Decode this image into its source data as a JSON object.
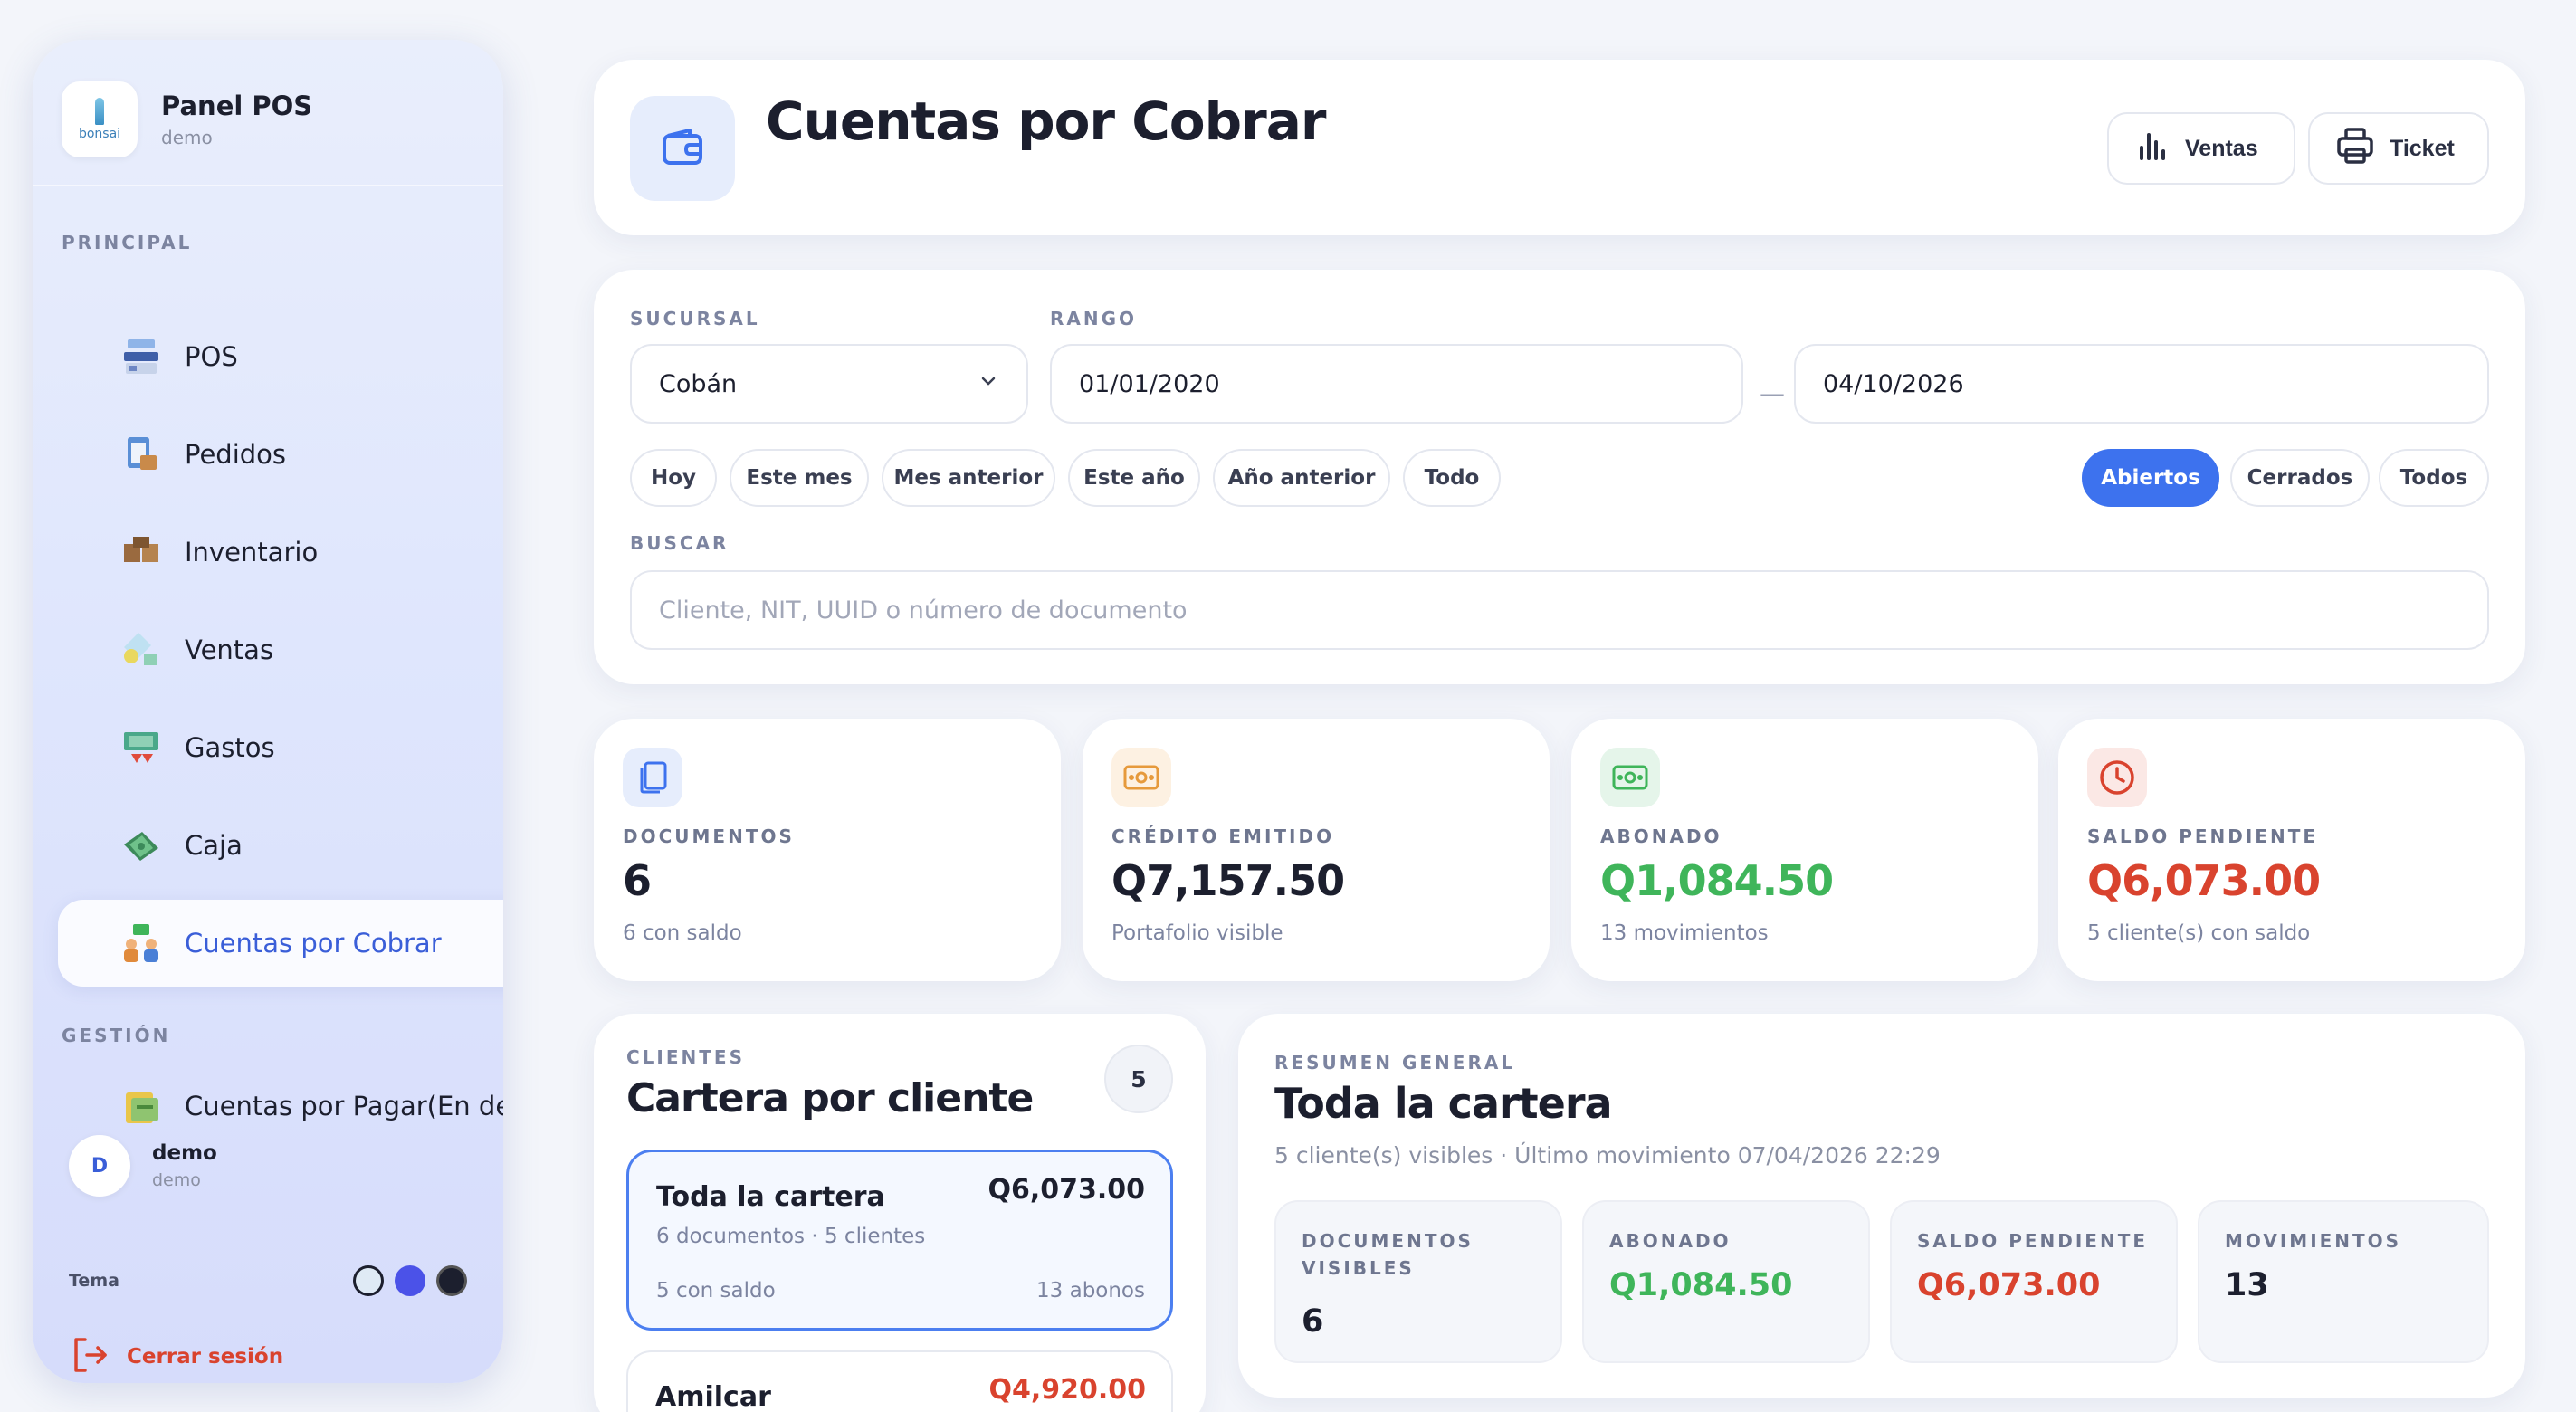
{
  "sidebar": {
    "brand_title": "Panel POS",
    "brand_sub": "demo",
    "logo_text": "bonsai",
    "section_principal": "PRINCIPAL",
    "section_gestion": "GESTIÓN",
    "items": [
      {
        "label": "POS",
        "icon": "pos-terminal-icon"
      },
      {
        "label": "Pedidos",
        "icon": "clipboard-box-icon"
      },
      {
        "label": "Inventario",
        "icon": "boxes-icon"
      },
      {
        "label": "Ventas",
        "icon": "sales-tag-icon"
      },
      {
        "label": "Gastos",
        "icon": "expenses-icon"
      },
      {
        "label": "Caja",
        "icon": "cash-money-icon"
      },
      {
        "label": "Cuentas por Cobrar",
        "icon": "people-money-icon",
        "active": true
      },
      {
        "label": "Cuentas por Pagar(En desarrollo)",
        "icon": "bills-icon"
      }
    ],
    "user": {
      "initial": "D",
      "name": "demo",
      "sub": "demo"
    },
    "theme_label": "Tema",
    "logout_label": "Cerrar sesión"
  },
  "header": {
    "title": "Cuentas por Cobrar",
    "btn_sales": "Ventas",
    "btn_ticket": "Ticket"
  },
  "filters": {
    "branch_label": "SUCURSAL",
    "branch_value": "Cobán",
    "range_label": "RANGO",
    "date_from": "01/01/2020",
    "date_to": "04/10/2026",
    "range_separator": "—",
    "quick_ranges": [
      "Hoy",
      "Este mes",
      "Mes anterior",
      "Este año",
      "Año anterior",
      "Todo"
    ],
    "status_options": [
      "Abiertos",
      "Cerrados",
      "Todos"
    ],
    "status_selected": "Abiertos",
    "search_label": "BUSCAR",
    "search_placeholder": "Cliente, NIT, UUID o número de documento"
  },
  "stats": [
    {
      "label": "DOCUMENTOS",
      "value": "6",
      "sub": "6 con saldo",
      "icon": "documents-icon",
      "color": "#1c1f2e"
    },
    {
      "label": "CRÉDITO EMITIDO",
      "value": "Q7,157.50",
      "sub": "Portafolio visible",
      "icon": "banknote-icon",
      "color": "#1c1f2e"
    },
    {
      "label": "ABONADO",
      "value": "Q1,084.50",
      "sub": "13 movimientos",
      "icon": "cash-icon",
      "color": "#3fb55a"
    },
    {
      "label": "SALDO PENDIENTE",
      "value": "Q6,073.00",
      "sub": "5 cliente(s) con saldo",
      "icon": "clock-icon",
      "color": "#d9432e"
    }
  ],
  "clients": {
    "label": "CLIENTES",
    "title": "Cartera por cliente",
    "count": "5",
    "items": [
      {
        "name": "Toda la cartera",
        "amount": "Q6,073.00",
        "sub": "6 documentos · 5 clientes",
        "foot_left": "5 con saldo",
        "foot_right": "13 abonos"
      },
      {
        "name": "Amilcar",
        "amount": "Q4,920.00"
      }
    ]
  },
  "summary": {
    "label": "RESUMEN GENERAL",
    "title": "Toda la cartera",
    "sub": "5 cliente(s) visibles · Último movimiento 07/04/2026 22:29",
    "metrics": [
      {
        "label": "DOCUMENTOS VISIBLES",
        "value": "6"
      },
      {
        "label": "ABONADO",
        "value": "Q1,084.50"
      },
      {
        "label": "SALDO PENDIENTE",
        "value": "Q6,073.00"
      },
      {
        "label": "MOVIMIENTOS",
        "value": "13"
      }
    ]
  },
  "colors": {
    "accent": "#3d72ee",
    "positive": "#3fb55a",
    "negative": "#d9432e"
  }
}
